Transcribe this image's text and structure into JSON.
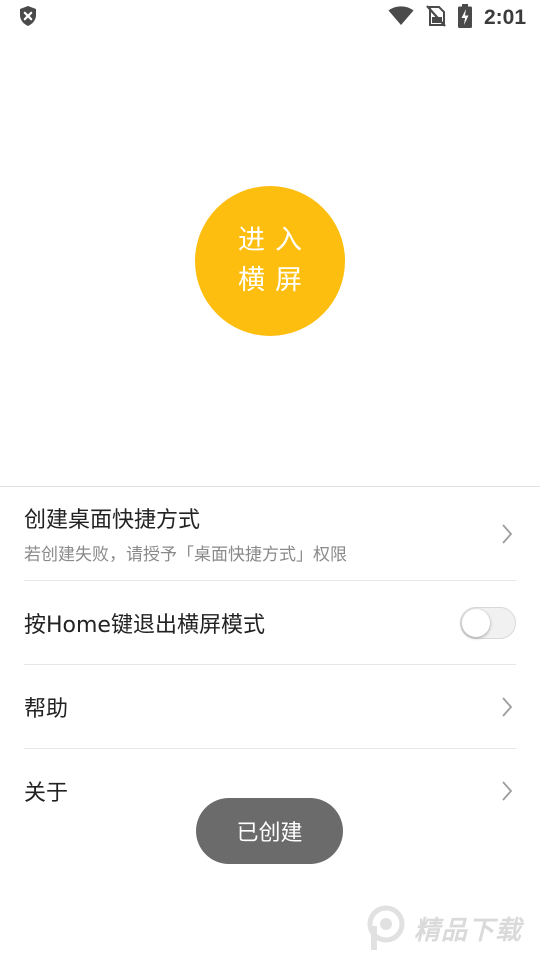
{
  "status_bar": {
    "time": "2:01",
    "icons": [
      "shield-x-icon",
      "wifi-icon",
      "no-sim-icon",
      "battery-charging-icon"
    ]
  },
  "main": {
    "enter_button": {
      "line1": "进入",
      "line2": "横屏",
      "color": "#fdbe0f"
    }
  },
  "settings": {
    "shortcut": {
      "title": "创建桌面快捷方式",
      "subtitle": "若创建失败，请授予「桌面快捷方式」权限"
    },
    "home_key_exit": {
      "title": "按Home键退出横屏模式",
      "enabled": false
    },
    "help": {
      "title": "帮助"
    },
    "about": {
      "title": "关于"
    }
  },
  "toast": {
    "text": "已创建"
  },
  "watermark": {
    "text": "精品下载"
  }
}
